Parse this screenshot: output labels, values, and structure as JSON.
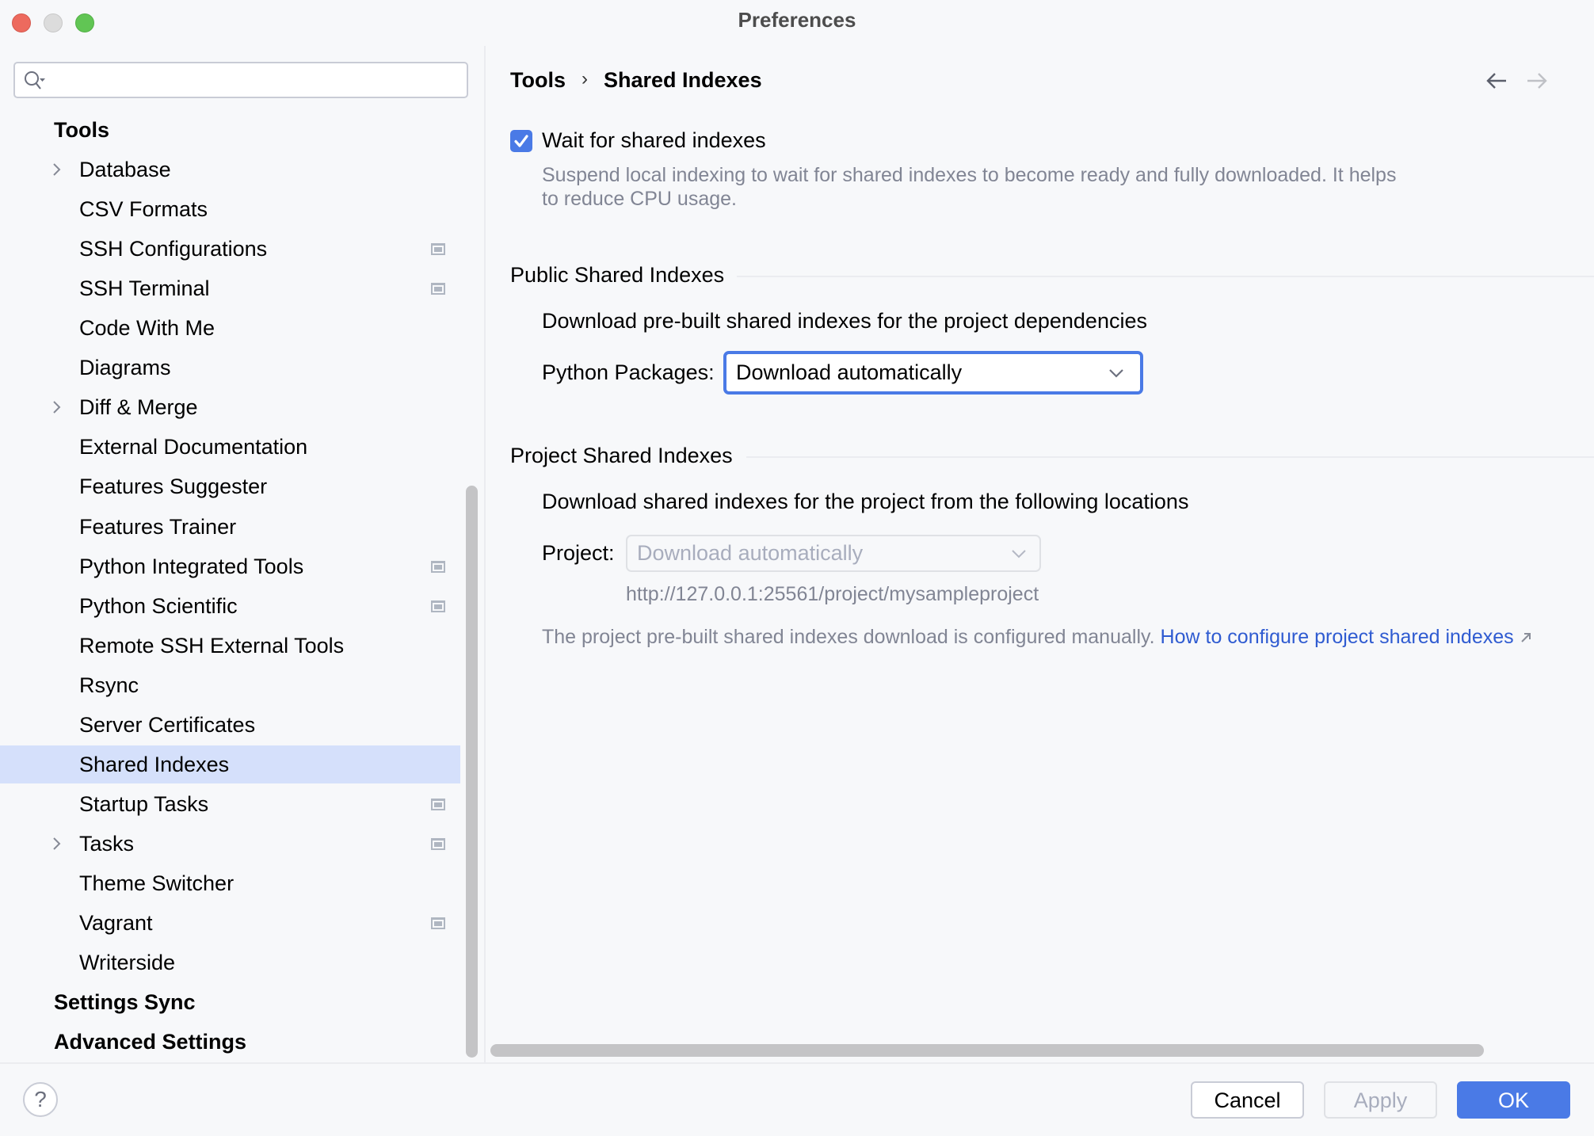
{
  "window": {
    "title": "Preferences"
  },
  "sidebar": {
    "search": {
      "value": "",
      "placeholder": ""
    },
    "items": [
      {
        "label": "Tools",
        "level": "top",
        "expandable": false,
        "project_level": false
      },
      {
        "label": "Database",
        "level": "child",
        "expandable": true,
        "project_level": false
      },
      {
        "label": "CSV Formats",
        "level": "child",
        "expandable": false,
        "project_level": false
      },
      {
        "label": "SSH Configurations",
        "level": "child",
        "expandable": false,
        "project_level": true
      },
      {
        "label": "SSH Terminal",
        "level": "child",
        "expandable": false,
        "project_level": true
      },
      {
        "label": "Code With Me",
        "level": "child",
        "expandable": false,
        "project_level": false
      },
      {
        "label": "Diagrams",
        "level": "child",
        "expandable": false,
        "project_level": false
      },
      {
        "label": "Diff & Merge",
        "level": "child",
        "expandable": true,
        "project_level": false
      },
      {
        "label": "External Documentation",
        "level": "child",
        "expandable": false,
        "project_level": false
      },
      {
        "label": "Features Suggester",
        "level": "child",
        "expandable": false,
        "project_level": false
      },
      {
        "label": "Features Trainer",
        "level": "child",
        "expandable": false,
        "project_level": false
      },
      {
        "label": "Python Integrated Tools",
        "level": "child",
        "expandable": false,
        "project_level": true
      },
      {
        "label": "Python Scientific",
        "level": "child",
        "expandable": false,
        "project_level": true
      },
      {
        "label": "Remote SSH External Tools",
        "level": "child",
        "expandable": false,
        "project_level": false
      },
      {
        "label": "Rsync",
        "level": "child",
        "expandable": false,
        "project_level": false
      },
      {
        "label": "Server Certificates",
        "level": "child",
        "expandable": false,
        "project_level": false
      },
      {
        "label": "Shared Indexes",
        "level": "child",
        "expandable": false,
        "project_level": false,
        "selected": true
      },
      {
        "label": "Startup Tasks",
        "level": "child",
        "expandable": false,
        "project_level": true
      },
      {
        "label": "Tasks",
        "level": "child",
        "expandable": true,
        "project_level": true
      },
      {
        "label": "Theme Switcher",
        "level": "child",
        "expandable": false,
        "project_level": false
      },
      {
        "label": "Vagrant",
        "level": "child",
        "expandable": false,
        "project_level": true
      },
      {
        "label": "Writerside",
        "level": "child",
        "expandable": false,
        "project_level": false
      },
      {
        "label": "Settings Sync",
        "level": "top",
        "expandable": false,
        "project_level": false
      },
      {
        "label": "Advanced Settings",
        "level": "top",
        "expandable": false,
        "project_level": false
      }
    ]
  },
  "breadcrumb": {
    "parent": "Tools",
    "separator": "›",
    "current": "Shared Indexes",
    "back_icon": "arrow-left-icon",
    "forward_icon": "arrow-right-icon"
  },
  "main": {
    "wait_checkbox": {
      "label": "Wait for shared indexes",
      "checked": true,
      "description_line1": "Suspend local indexing to wait for shared indexes to become ready and fully downloaded. It helps",
      "description_line2": "to reduce CPU usage."
    },
    "public_section": {
      "title": "Public Shared Indexes",
      "description": "Download pre-built shared indexes for the project dependencies",
      "python_packages_label": "Python Packages:",
      "python_packages_value": "Download automatically"
    },
    "project_section": {
      "title": "Project Shared Indexes",
      "description": "Download shared indexes for the project from the following locations",
      "project_label": "Project:",
      "project_value": "Download automatically",
      "project_url": "http://127.0.0.1:25561/project/mysampleproject",
      "note": "The project pre-built shared indexes download is configured manually.",
      "link_text": "How to configure project shared indexes",
      "link_icon": "external-link-icon"
    }
  },
  "footer": {
    "help_label": "?",
    "cancel_label": "Cancel",
    "apply_label": "Apply",
    "ok_label": "OK"
  },
  "colors": {
    "accent": "#4a7ae6",
    "selection": "#d5e0fb",
    "link": "#2f5bd1",
    "muted_text": "#818594",
    "background": "#f7f8fa"
  }
}
